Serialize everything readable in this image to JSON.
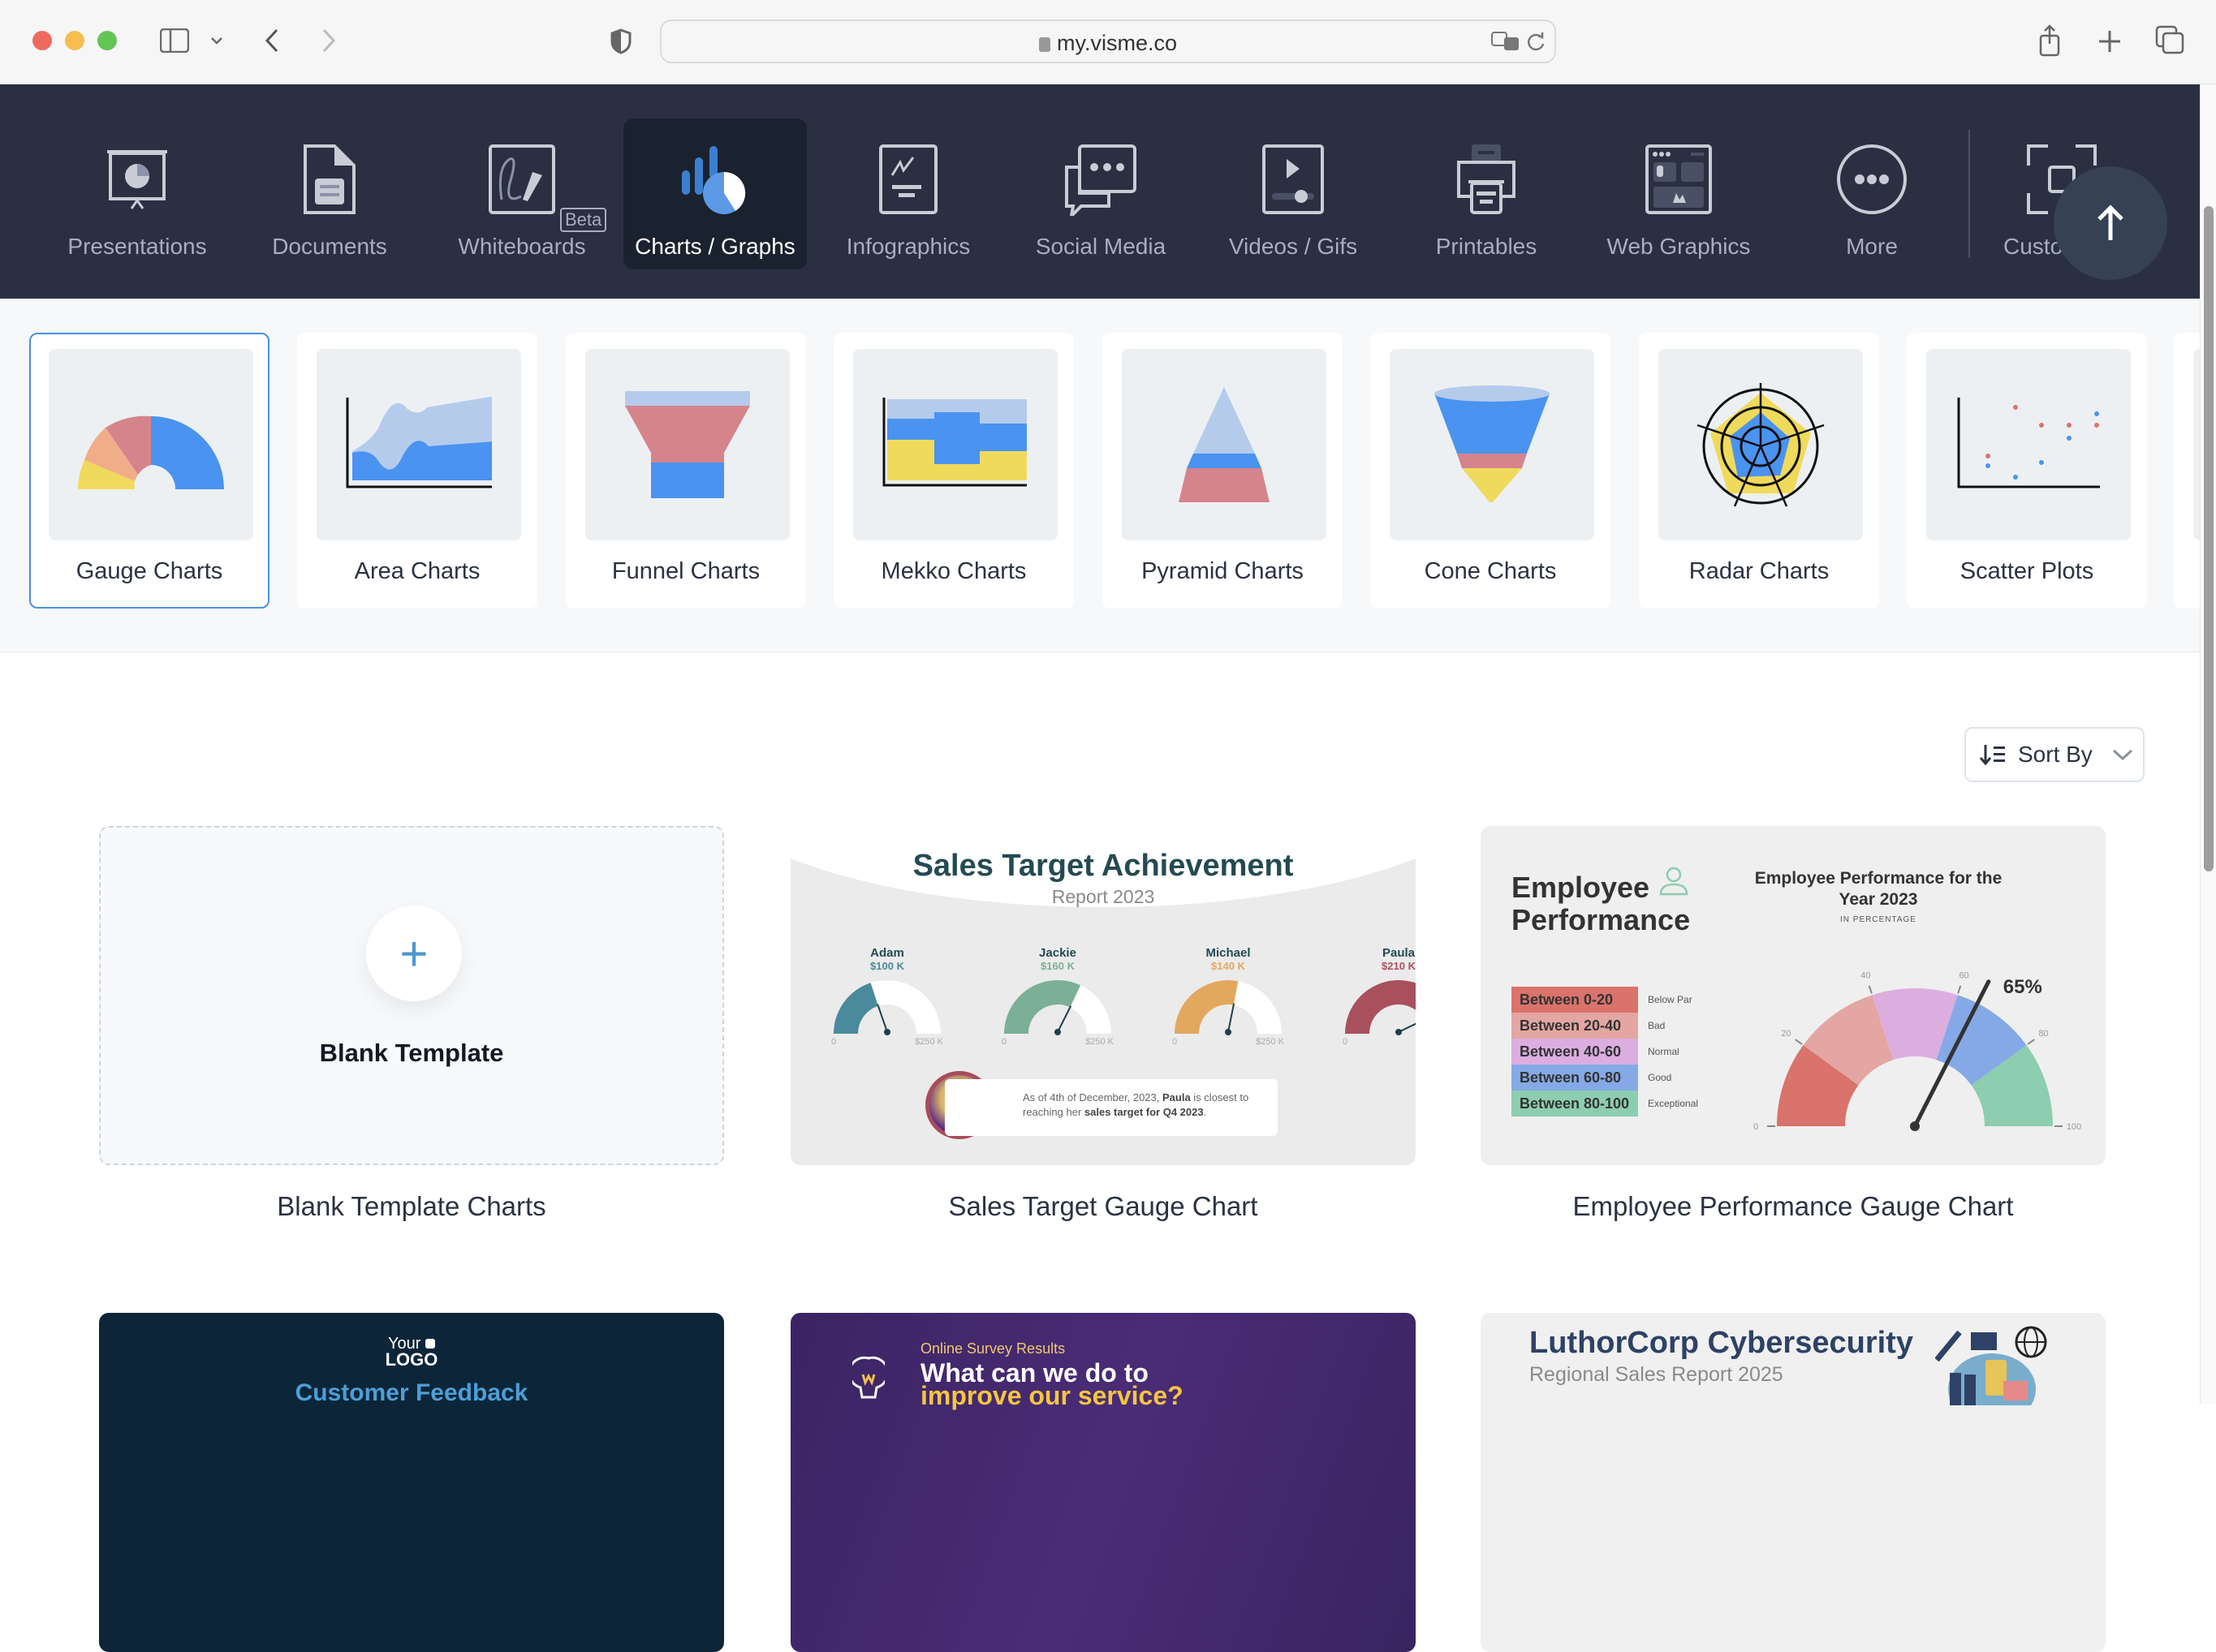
{
  "browser": {
    "url": "my.visme.co",
    "icons": [
      "sidebar-icon",
      "chevron-down-icon",
      "back-icon",
      "forward-icon",
      "shield-icon",
      "lock-icon",
      "translate-icon",
      "reload-icon",
      "share-icon",
      "new-tab-icon",
      "tabs-overview-icon"
    ]
  },
  "nav": {
    "items": [
      {
        "label": "Presentations",
        "icon": "presentation-icon"
      },
      {
        "label": "Documents",
        "icon": "document-icon"
      },
      {
        "label": "Whiteboards",
        "icon": "whiteboard-icon",
        "badge": "Beta"
      },
      {
        "label": "Charts / Graphs",
        "icon": "chart-icon",
        "active": true
      },
      {
        "label": "Infographics",
        "icon": "infographic-icon"
      },
      {
        "label": "Social Media",
        "icon": "chat-bubbles-icon"
      },
      {
        "label": "Videos / Gifs",
        "icon": "video-icon"
      },
      {
        "label": "Printables",
        "icon": "printer-icon"
      },
      {
        "label": "Web Graphics",
        "icon": "web-graphic-icon"
      },
      {
        "label": "More",
        "icon": "more-icon"
      },
      {
        "label": "Custo",
        "icon": "custom-size-icon"
      }
    ],
    "scroll_top_icon": "arrow-up-icon"
  },
  "chart_types": [
    {
      "label": "Gauge Charts",
      "active": true
    },
    {
      "label": "Area Charts"
    },
    {
      "label": "Funnel Charts"
    },
    {
      "label": "Mekko Charts"
    },
    {
      "label": "Pyramid Charts"
    },
    {
      "label": "Cone Charts"
    },
    {
      "label": "Radar Charts"
    },
    {
      "label": "Scatter Plots"
    }
  ],
  "sort": {
    "label": "Sort By"
  },
  "templates": [
    {
      "caption": "Blank Template Charts",
      "title": "Blank Template"
    },
    {
      "caption": "Sales Target Gauge Chart",
      "title": "Sales Target Achievement",
      "subtitle": "Report 2023",
      "gauges": [
        {
          "name": "Adam",
          "value_label": "$100 K",
          "value": 100,
          "color": "#4a8a9c"
        },
        {
          "name": "Jackie",
          "value_label": "$160 K",
          "value": 160,
          "color": "#7bb096"
        },
        {
          "name": "Michael",
          "value_label": "$140 K",
          "value": 140,
          "color": "#e2a85e"
        },
        {
          "name": "Paula",
          "value_label": "$210 K",
          "value": 210,
          "color": "#a9505d"
        }
      ],
      "min_label": "0",
      "max_label": "$250 K",
      "max": 250,
      "note_pre": "As of 4th of December, 2023, ",
      "note_name": "Paula",
      "note_mid": " is closest to reaching her ",
      "note_bold": "sales target for Q4 2023",
      "note_end": "."
    },
    {
      "caption": "Employee Performance Gauge Chart",
      "title_line1": "Employee",
      "title_line2": "Performance",
      "chart_title": "Employee Performance for the Year 2023",
      "chart_sub": "IN PERCENTAGE",
      "value": 65,
      "value_label": "65%",
      "ticks": [
        "0",
        "20",
        "40",
        "60",
        "80",
        "100"
      ],
      "legend": [
        {
          "range": "Between 0-20",
          "label": "Below Par",
          "color": "#d9736b"
        },
        {
          "range": "Between 20-40",
          "label": "Bad",
          "color": "#e3a6a2"
        },
        {
          "range": "Between 40-60",
          "label": "Normal",
          "color": "#dcaee0"
        },
        {
          "range": "Between 60-80",
          "label": "Good",
          "color": "#85a9e6"
        },
        {
          "range": "Between 80-100",
          "label": "Exceptional",
          "color": "#8dcdb0"
        }
      ]
    },
    {
      "logo_line1": "Your",
      "logo_line2": "LOGO",
      "title": "Customer Feedback"
    },
    {
      "kicker": "Online Survey Results",
      "title_line1": "What can we do to",
      "title_line2": "improve our service?"
    },
    {
      "title": "LuthorCorp Cybersecurity",
      "subtitle": "Regional Sales Report 2025"
    }
  ]
}
